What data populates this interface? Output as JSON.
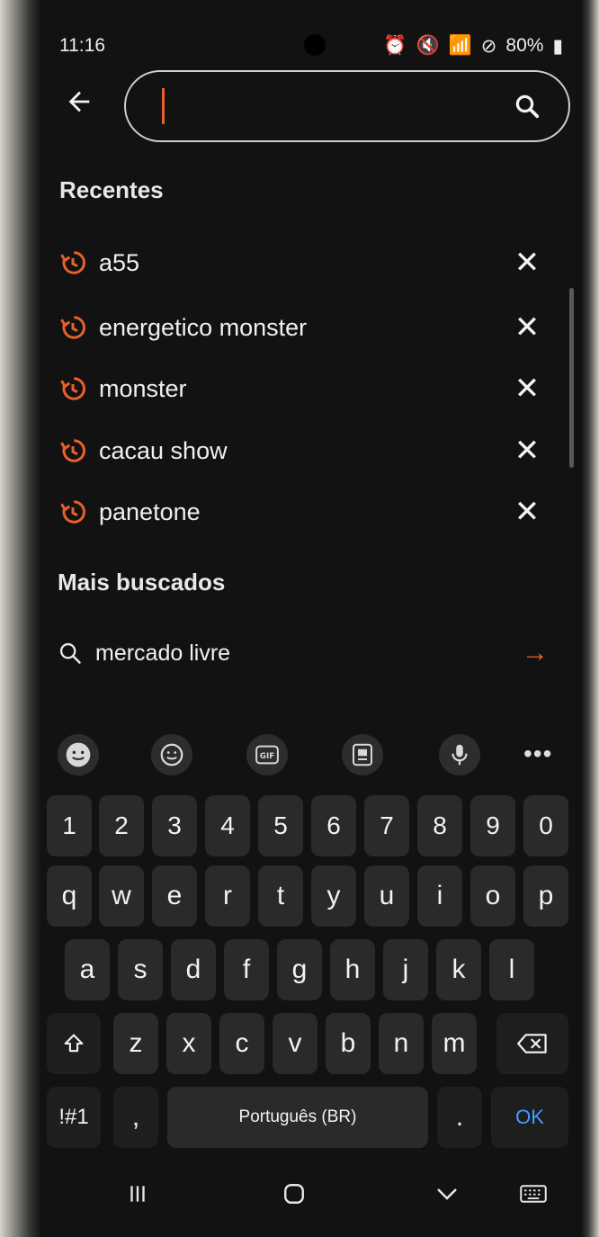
{
  "status_bar": {
    "time": "11:16",
    "battery": "80%",
    "icons": [
      "alarm-icon",
      "mute-icon",
      "wifi-icon",
      "no-disturb-icon",
      "volte-icon",
      "signal-icon",
      "battery-icon"
    ]
  },
  "search": {
    "value": "",
    "placeholder": ""
  },
  "recents": {
    "title": "Recentes",
    "items": [
      {
        "label": "a55"
      },
      {
        "label": "energetico monster"
      },
      {
        "label": "monster"
      },
      {
        "label": "cacau show"
      },
      {
        "label": "panetone"
      }
    ]
  },
  "popular": {
    "title": "Mais buscados",
    "items": [
      {
        "label": "mercado livre"
      }
    ]
  },
  "keyboard": {
    "toolbar": [
      "emoji-icon",
      "sticker-icon",
      "gif-icon",
      "clipboard-icon",
      "mic-icon",
      "more-icon"
    ],
    "number_row": [
      "1",
      "2",
      "3",
      "4",
      "5",
      "6",
      "7",
      "8",
      "9",
      "0"
    ],
    "row1": [
      "q",
      "w",
      "e",
      "r",
      "t",
      "y",
      "u",
      "i",
      "o",
      "p"
    ],
    "row2": [
      "a",
      "s",
      "d",
      "f",
      "g",
      "h",
      "j",
      "k",
      "l"
    ],
    "row3": [
      "z",
      "x",
      "c",
      "v",
      "b",
      "n",
      "m"
    ],
    "symbols_label": "!#1",
    "comma": ",",
    "space_label": "Português (BR)",
    "period": ".",
    "ok_label": "OK"
  },
  "colors": {
    "accent": "#e8602c",
    "ok_blue": "#3fa0ff",
    "background": "#121212"
  }
}
